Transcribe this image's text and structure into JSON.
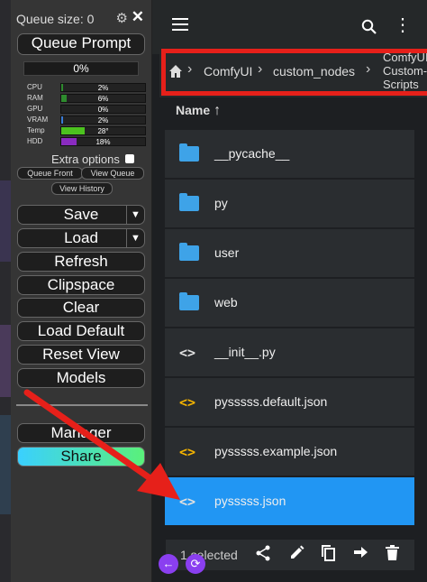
{
  "menu": {
    "queue_size": "Queue size: 0",
    "queue_prompt": "Queue Prompt",
    "progress": "0%",
    "stats": [
      {
        "label": "CPU",
        "value": "2%",
        "fraction": 0.02,
        "color": "#2e8b2e"
      },
      {
        "label": "RAM",
        "value": "6%",
        "fraction": 0.06,
        "color": "#2e8b2e"
      },
      {
        "label": "GPU",
        "value": "0%",
        "fraction": 0.0,
        "color": "#2e8b2e"
      },
      {
        "label": "VRAM",
        "value": "2%",
        "fraction": 0.02,
        "color": "#3a7bd5"
      },
      {
        "label": "Temp",
        "value": "28°",
        "fraction": 0.28,
        "color": "#4cc21f"
      },
      {
        "label": "HDD",
        "value": "18%",
        "fraction": 0.18,
        "color": "#8a2bc0"
      }
    ],
    "extra_options": "Extra options",
    "queue_front": "Queue Front",
    "view_queue": "View Queue",
    "view_history": "View History",
    "save": "Save",
    "load": "Load",
    "refresh": "Refresh",
    "clipspace": "Clipspace",
    "clear": "Clear",
    "load_default": "Load Default",
    "reset_view": "Reset View",
    "models": "Models",
    "manager": "Manager",
    "share": "Share"
  },
  "breadcrumb": {
    "items": [
      "ComfyUI",
      "custom_nodes"
    ],
    "last_lines": [
      "ComfyUI-",
      "Custom-",
      "Scripts"
    ]
  },
  "column_header": "Name",
  "files": [
    {
      "name": "__pycache__",
      "type": "folder"
    },
    {
      "name": "py",
      "type": "folder"
    },
    {
      "name": "user",
      "type": "folder"
    },
    {
      "name": "web",
      "type": "folder"
    },
    {
      "name": "__init__.py",
      "type": "python"
    },
    {
      "name": "pysssss.default.json",
      "type": "json"
    },
    {
      "name": "pysssss.example.json",
      "type": "json"
    },
    {
      "name": "pysssss.json",
      "type": "json",
      "selected": true
    }
  ],
  "selection_text": "1 selected",
  "colors": {
    "highlight_box": "#e6201a",
    "selected_row": "#2196f3",
    "folder": "#3ea3e8",
    "json_icon": "#f5b400"
  }
}
